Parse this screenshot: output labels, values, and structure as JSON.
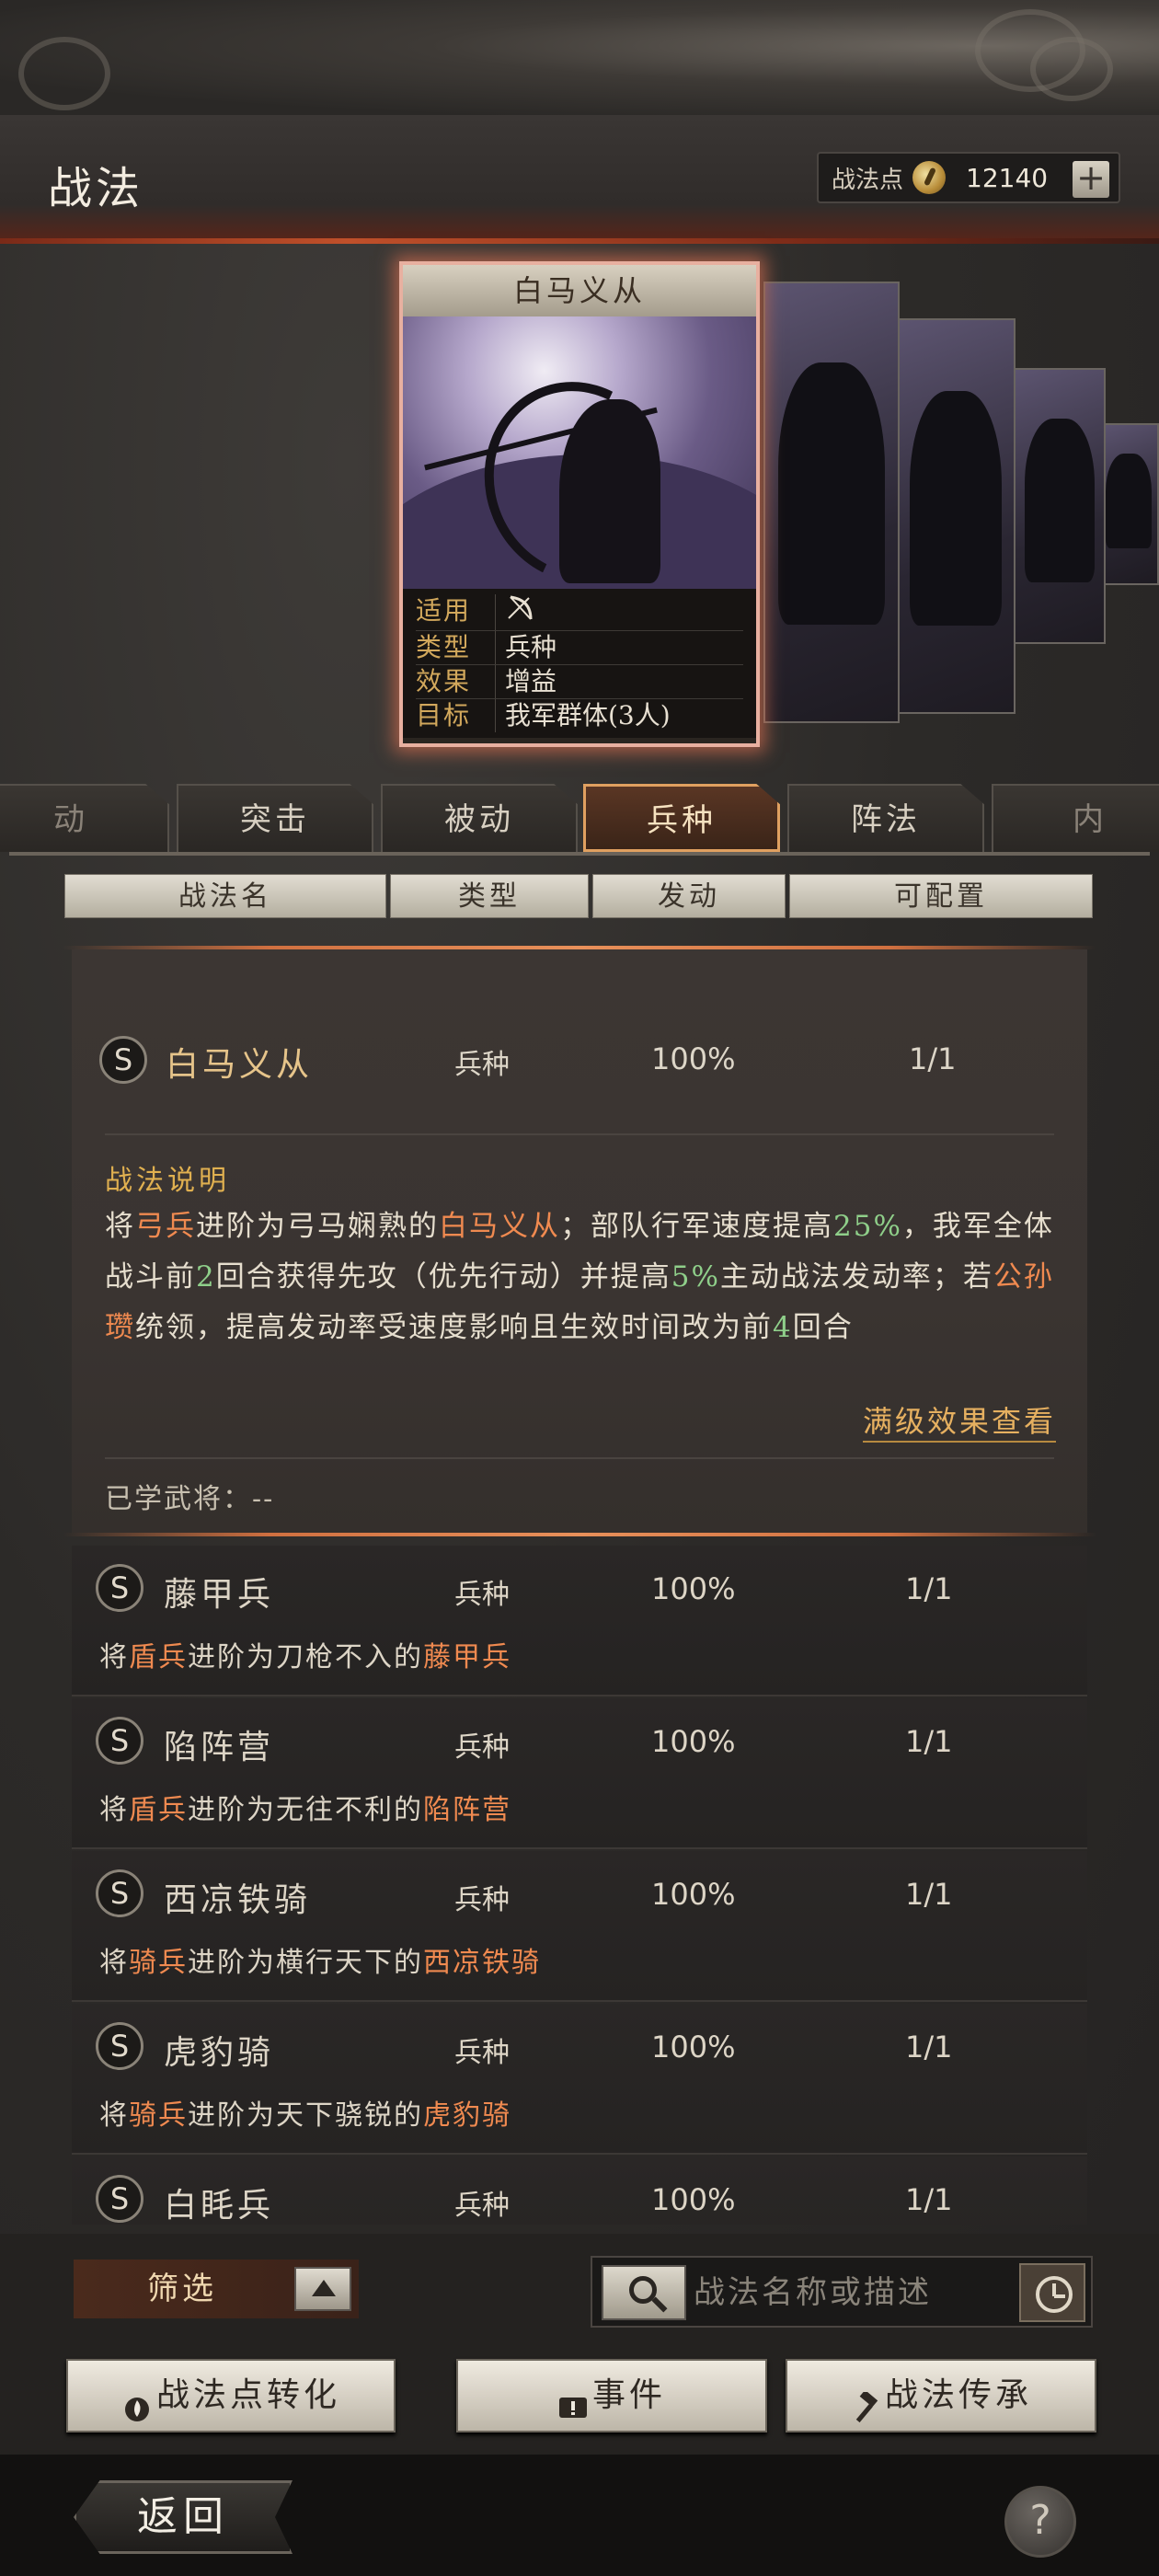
{
  "header": {
    "title": "战法",
    "points_label": "战法点",
    "points_value": "12140",
    "plus": "+"
  },
  "card": {
    "title": "白马义从",
    "info": [
      {
        "k": "适用",
        "v": ""
      },
      {
        "k": "类型",
        "v": "兵种"
      },
      {
        "k": "效果",
        "v": "增益"
      },
      {
        "k": "目标",
        "v": "我军群体(3人)"
      }
    ]
  },
  "tabs": [
    {
      "label": "动"
    },
    {
      "label": "突击"
    },
    {
      "label": "被动"
    },
    {
      "label": "兵种",
      "active": true
    },
    {
      "label": "阵法"
    },
    {
      "label": "内"
    }
  ],
  "columns": [
    "战法名",
    "类型",
    "发动",
    "可配置"
  ],
  "expanded": {
    "grade": "S",
    "name": "白马义从",
    "type": "兵种",
    "rate": "100%",
    "cap": "1/1",
    "desc_title": "战法说明",
    "desc_parts": [
      {
        "t": "将",
        "c": ""
      },
      {
        "t": "弓兵",
        "c": "or"
      },
      {
        "t": "进阶为弓马娴熟的",
        "c": ""
      },
      {
        "t": "白马义从",
        "c": "or"
      },
      {
        "t": "；部队行军速度提高",
        "c": ""
      },
      {
        "t": "25%",
        "c": "gr"
      },
      {
        "t": "，我军全体战斗前",
        "c": ""
      },
      {
        "t": "2",
        "c": "gr"
      },
      {
        "t": "回合获得先攻（优先行动）并提高",
        "c": ""
      },
      {
        "t": "5%",
        "c": "gr"
      },
      {
        "t": "主动战法发动率；若",
        "c": ""
      },
      {
        "t": "公孙瓒",
        "c": "or"
      },
      {
        "t": "统领，提高发动率受速度影响且生效时间改为前",
        "c": ""
      },
      {
        "t": "4",
        "c": "gr"
      },
      {
        "t": "回合",
        "c": ""
      }
    ],
    "more_link": "满级效果查看",
    "learned": "已学武将：--"
  },
  "rows": [
    {
      "grade": "S",
      "name": "藤甲兵",
      "type": "兵种",
      "rate": "100%",
      "cap": "1/1",
      "d1": "将",
      "d2": "盾兵",
      "d3": "进阶为刀枪不入的",
      "d4": "藤甲兵"
    },
    {
      "grade": "S",
      "name": "陷阵营",
      "type": "兵种",
      "rate": "100%",
      "cap": "1/1",
      "d1": "将",
      "d2": "盾兵",
      "d3": "进阶为无往不利的",
      "d4": "陷阵营"
    },
    {
      "grade": "S",
      "name": "西凉铁骑",
      "type": "兵种",
      "rate": "100%",
      "cap": "1/1",
      "d1": "将",
      "d2": "骑兵",
      "d3": "进阶为横行天下的",
      "d4": "西凉铁骑"
    },
    {
      "grade": "S",
      "name": "虎豹骑",
      "type": "兵种",
      "rate": "100%",
      "cap": "1/1",
      "d1": "将",
      "d2": "骑兵",
      "d3": "进阶为天下骁锐的",
      "d4": "虎豹骑"
    },
    {
      "grade": "S",
      "name": "白眊兵",
      "type": "兵种",
      "rate": "100%",
      "cap": "1/1",
      "d1": "",
      "d2": "",
      "d3": "",
      "d4": ""
    }
  ],
  "bottom": {
    "filter": "筛选",
    "search_placeholder": "战法名称或描述",
    "btn_convert": "战法点转化",
    "btn_event": "事件",
    "btn_inherit": "战法传承"
  },
  "footer": {
    "back": "返回",
    "help": "?"
  }
}
